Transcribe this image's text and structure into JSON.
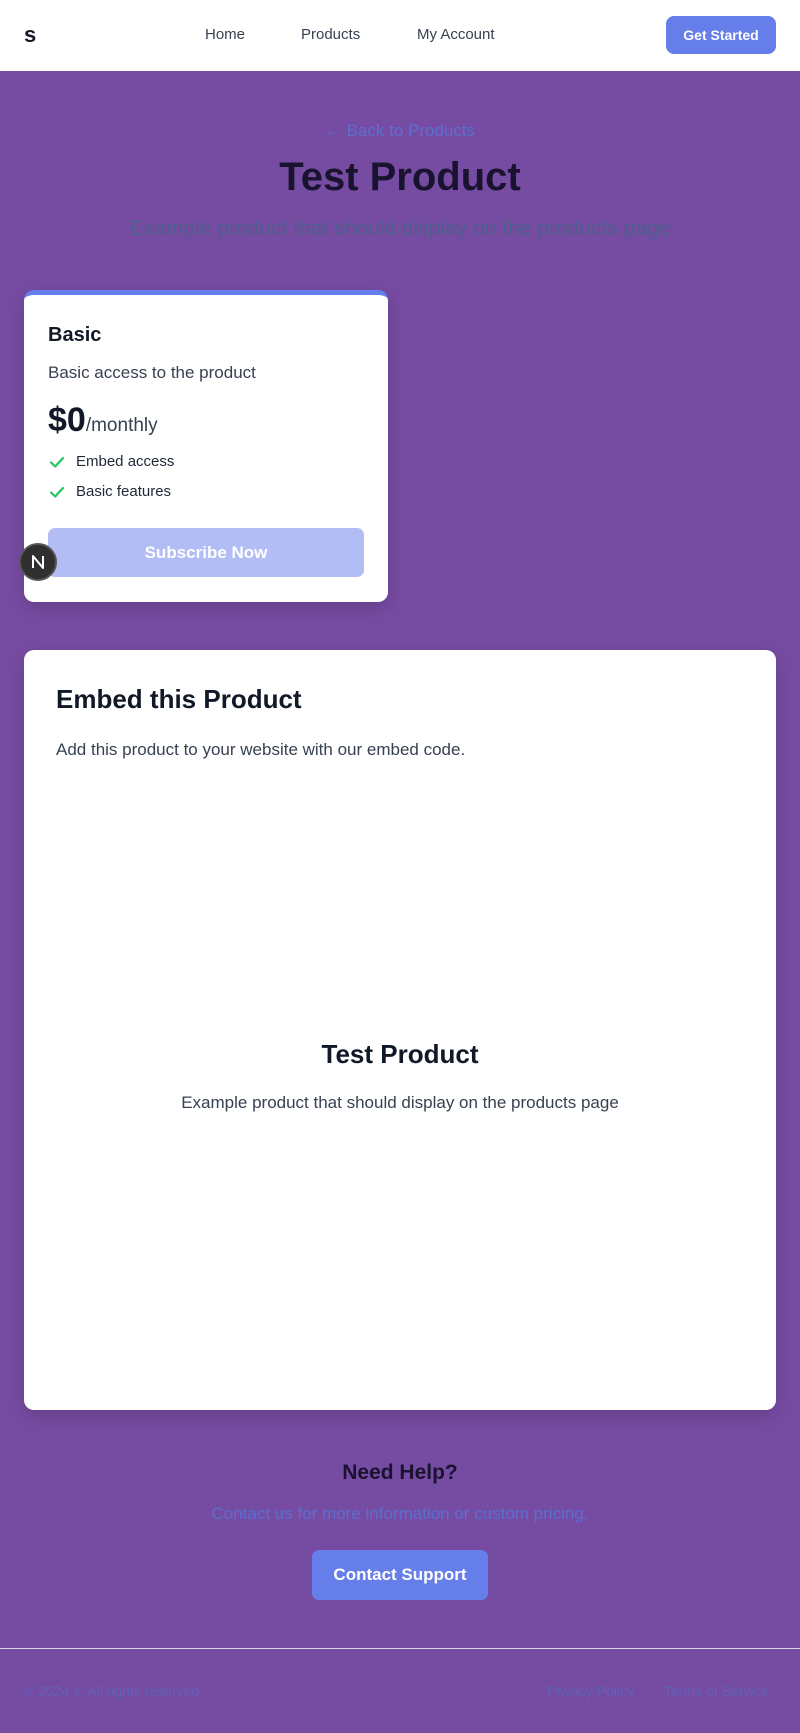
{
  "nav": {
    "logo": "s",
    "links": [
      "Home",
      "Products",
      "My Account"
    ],
    "cta": "Get Started"
  },
  "hero": {
    "back_link": "← Back to Products",
    "title": "Test Product",
    "subtitle": "Example product that should display on the products page"
  },
  "plan": {
    "name": "Basic",
    "description": "Basic access to the product",
    "price": "$0",
    "period": "/monthly",
    "features": [
      "Embed access",
      "Basic features"
    ],
    "button": "Subscribe Now"
  },
  "badge": {
    "icon": "n-logo-icon"
  },
  "embed": {
    "title": "Embed this Product",
    "description": "Add this product to your website with our embed code.",
    "preview": {
      "title": "Test Product",
      "description": "Example product that should display on the products page"
    }
  },
  "help": {
    "title": "Need Help?",
    "description": "Contact us for more information or custom pricing.",
    "button": "Contact Support"
  },
  "footer": {
    "copyright": "© 2024 s. All rights reserved.",
    "links": [
      "Privacy Policy",
      "Terms of Service"
    ]
  },
  "colors": {
    "background": "#764ba2",
    "accent": "#667eea",
    "check": "#22c55e"
  }
}
